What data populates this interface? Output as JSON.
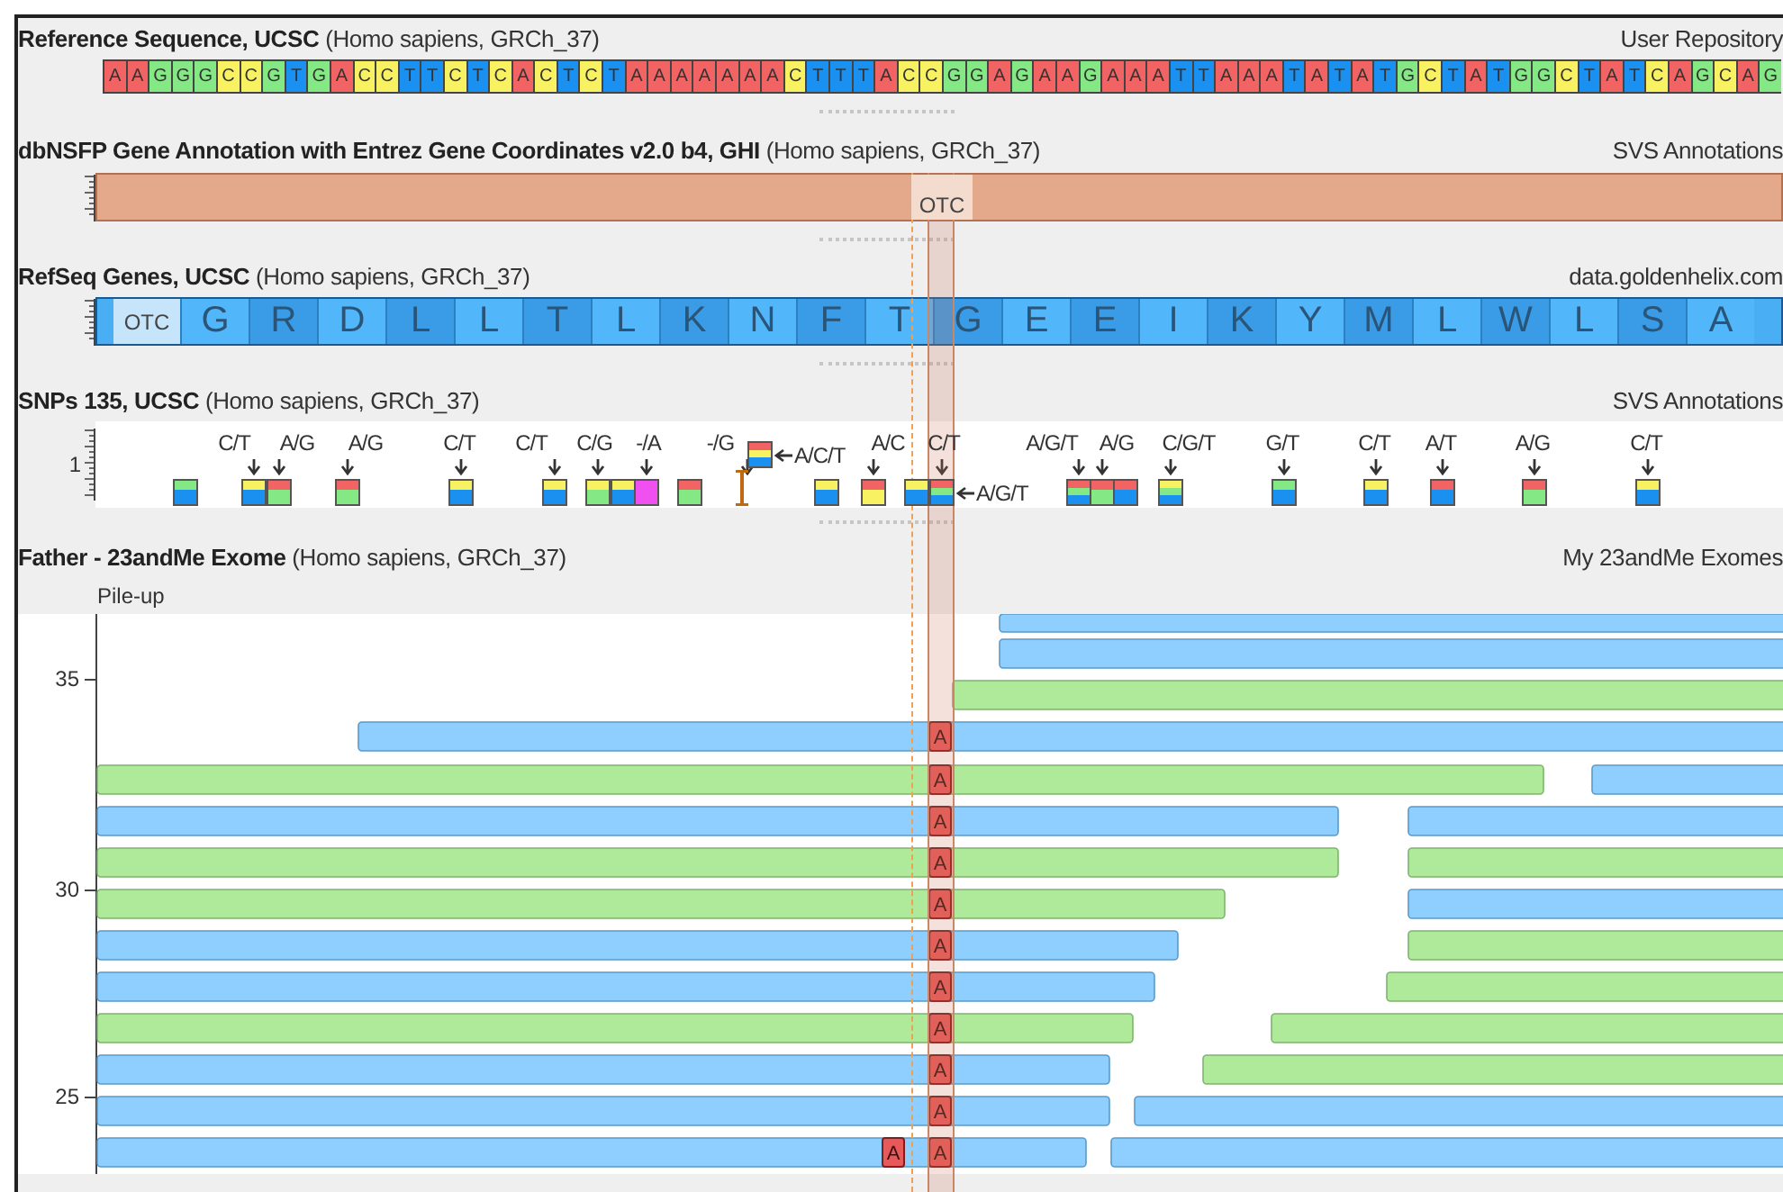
{
  "tracks": [
    {
      "kind": "sequence",
      "title": "**Reference Sequence, UCSC** (Homo sapiens, GRCh_37)",
      "source": "User Repository",
      "bases": [
        {
          "base": "A",
          "color": "#f26464"
        },
        {
          "base": "A",
          "color": "#f26464"
        },
        {
          "base": "G",
          "color": "#84e884"
        },
        {
          "base": "G",
          "color": "#84e884"
        },
        {
          "base": "G",
          "color": "#84e884"
        },
        {
          "base": "C",
          "color": "#f8f262"
        },
        {
          "base": "C",
          "color": "#f8f262"
        },
        {
          "base": "G",
          "color": "#84e884"
        },
        {
          "base": "T",
          "color": "#1a90f0"
        },
        {
          "base": "G",
          "color": "#84e884"
        },
        {
          "base": "A",
          "color": "#f26464"
        },
        {
          "base": "C",
          "color": "#f8f262"
        },
        {
          "base": "C",
          "color": "#f8f262"
        },
        {
          "base": "T",
          "color": "#1a90f0"
        },
        {
          "base": "T",
          "color": "#1a90f0"
        },
        {
          "base": "C",
          "color": "#f8f262"
        },
        {
          "base": "T",
          "color": "#1a90f0"
        },
        {
          "base": "C",
          "color": "#f8f262"
        },
        {
          "base": "A",
          "color": "#f26464"
        },
        {
          "base": "C",
          "color": "#f8f262"
        },
        {
          "base": "T",
          "color": "#1a90f0"
        },
        {
          "base": "C",
          "color": "#f8f262"
        },
        {
          "base": "T",
          "color": "#1a90f0"
        },
        {
          "base": "A",
          "color": "#f26464"
        },
        {
          "base": "A",
          "color": "#f26464"
        },
        {
          "base": "A",
          "color": "#f26464"
        },
        {
          "base": "A",
          "color": "#f26464"
        },
        {
          "base": "A",
          "color": "#f26464"
        },
        {
          "base": "A",
          "color": "#f26464"
        },
        {
          "base": "A",
          "color": "#f26464"
        },
        {
          "base": "C",
          "color": "#f8f262"
        },
        {
          "base": "T",
          "color": "#1a90f0"
        },
        {
          "base": "T",
          "color": "#1a90f0"
        },
        {
          "base": "T",
          "color": "#1a90f0"
        },
        {
          "base": "A",
          "color": "#f26464"
        },
        {
          "base": "C",
          "color": "#f8f262"
        },
        {
          "base": "C",
          "color": "#f8f262"
        },
        {
          "base": "G",
          "color": "#84e884"
        },
        {
          "base": "G",
          "color": "#84e884"
        },
        {
          "base": "A",
          "color": "#f26464"
        },
        {
          "base": "G",
          "color": "#84e884"
        },
        {
          "base": "A",
          "color": "#f26464"
        },
        {
          "base": "A",
          "color": "#f26464"
        },
        {
          "base": "G",
          "color": "#84e884"
        },
        {
          "base": "A",
          "color": "#f26464"
        },
        {
          "base": "A",
          "color": "#f26464"
        },
        {
          "base": "A",
          "color": "#f26464"
        },
        {
          "base": "T",
          "color": "#1a90f0"
        },
        {
          "base": "T",
          "color": "#1a90f0"
        },
        {
          "base": "A",
          "color": "#f26464"
        },
        {
          "base": "A",
          "color": "#f26464"
        },
        {
          "base": "A",
          "color": "#f26464"
        },
        {
          "base": "T",
          "color": "#1a90f0"
        },
        {
          "base": "A",
          "color": "#f26464"
        },
        {
          "base": "T",
          "color": "#1a90f0"
        },
        {
          "base": "A",
          "color": "#f26464"
        },
        {
          "base": "T",
          "color": "#1a90f0"
        },
        {
          "base": "G",
          "color": "#84e884"
        },
        {
          "base": "C",
          "color": "#f8f262"
        },
        {
          "base": "T",
          "color": "#1a90f0"
        },
        {
          "base": "A",
          "color": "#f26464"
        },
        {
          "base": "T",
          "color": "#1a90f0"
        },
        {
          "base": "G",
          "color": "#84e884"
        },
        {
          "base": "G",
          "color": "#84e884"
        },
        {
          "base": "C",
          "color": "#f8f262"
        },
        {
          "base": "T",
          "color": "#1a90f0"
        },
        {
          "base": "A",
          "color": "#f26464"
        },
        {
          "base": "T",
          "color": "#1a90f0"
        },
        {
          "base": "C",
          "color": "#f8f262"
        },
        {
          "base": "A",
          "color": "#f26464"
        },
        {
          "base": "G",
          "color": "#84e884"
        },
        {
          "base": "C",
          "color": "#f8f262"
        },
        {
          "base": "A",
          "color": "#f26464"
        },
        {
          "base": "G",
          "color": "#84e884"
        }
      ]
    },
    {
      "kind": "gene",
      "title": "**dbNSFP Gene Annotation with Entrez Gene Coordinates v2.0 b4, GHI** (Homo sapiens, GRCh_37)",
      "source": "SVS Annotations",
      "gene": "OTC"
    },
    {
      "kind": "protein",
      "title": "**RefSeq Genes, UCSC** (Homo sapiens, GRCh_37)",
      "source": "data.goldenhelix.com",
      "gene": "OTC",
      "amino_acids": [
        "G",
        "R",
        "D",
        "L",
        "L",
        "T",
        "L",
        "K",
        "N",
        "F",
        "T",
        "G",
        "E",
        "E",
        "I",
        "K",
        "Y",
        "M",
        "L",
        "W",
        "L",
        "S",
        "A"
      ]
    },
    {
      "kind": "variants",
      "title": "**SNPs 135, UCSC** (Homo sapiens, GRCh_37)",
      "source": "SVS Annotations",
      "scale_label": "1",
      "snps": [
        {
          "kind": "marker",
          "stripes": [
            {
              "color": "#84e884"
            },
            {
              "color": "#1a90f0"
            }
          ]
        },
        {
          "kind": "marker",
          "label": "C/T",
          "stripes": [
            {
              "color": "#f8f262"
            },
            {
              "color": "#1a90f0"
            }
          ]
        },
        {
          "kind": "marker",
          "label": "A/G",
          "stripes": [
            {
              "color": "#f26464"
            },
            {
              "color": "#84e884"
            }
          ]
        },
        {
          "kind": "marker",
          "label": "A/G",
          "stripes": [
            {
              "color": "#f26464"
            },
            {
              "color": "#84e884"
            }
          ]
        },
        {
          "kind": "marker",
          "label": "C/T",
          "stripes": [
            {
              "color": "#f8f262"
            },
            {
              "color": "#1a90f0"
            }
          ]
        },
        {
          "kind": "marker",
          "label": "C/T",
          "stripes": [
            {
              "color": "#f8f262"
            },
            {
              "color": "#1a90f0"
            }
          ]
        },
        {
          "kind": "marker",
          "label": "C/G",
          "stripes": [
            {
              "color": "#f8f262"
            },
            {
              "color": "#84e884"
            }
          ]
        },
        {
          "kind": "marker",
          "stripes": [
            {
              "color": "#f8f262"
            },
            {
              "color": "#1a90f0"
            }
          ]
        },
        {
          "kind": "marker",
          "label": "-/A",
          "stripes": [
            {
              "color": "#f050f0"
            }
          ]
        },
        {
          "kind": "marker",
          "stripes": [
            {
              "color": "#f26464"
            },
            {
              "color": "#84e884"
            }
          ]
        },
        {
          "kind": "insertion",
          "label": "-/G"
        },
        {
          "kind": "raised",
          "side_label": "A/C/T",
          "stripes": [
            {
              "color": "#f26464"
            },
            {
              "color": "#f8f262"
            },
            {
              "color": "#1a90f0"
            }
          ]
        },
        {
          "kind": "marker",
          "stripes": [
            {
              "color": "#f8f262"
            },
            {
              "color": "#1a90f0"
            }
          ]
        },
        {
          "kind": "marker",
          "label": "A/C",
          "stripes": [
            {
              "color": "#f26464"
            },
            {
              "color": "#f8f262"
            }
          ]
        },
        {
          "kind": "marker",
          "stripes": [
            {
              "color": "#f8f262"
            },
            {
              "color": "#1a90f0"
            }
          ]
        },
        {
          "kind": "marker",
          "label": "C/T",
          "side_label": "A/G/T",
          "stripes": [
            {
              "color": "#f26464"
            },
            {
              "color": "#84e884"
            },
            {
              "color": "#1a90f0"
            }
          ]
        },
        {
          "kind": "marker",
          "label": "A/G/T",
          "stripes": [
            {
              "color": "#f26464"
            },
            {
              "color": "#84e884"
            },
            {
              "color": "#1a90f0"
            }
          ]
        },
        {
          "kind": "marker",
          "label": "A/G",
          "stripes": [
            {
              "color": "#f26464"
            },
            {
              "color": "#84e884"
            }
          ]
        },
        {
          "kind": "marker",
          "stripes": [
            {
              "color": "#f26464"
            },
            {
              "color": "#1a90f0"
            }
          ]
        },
        {
          "kind": "marker",
          "label": "C/G/T",
          "stripes": [
            {
              "color": "#f8f262"
            },
            {
              "color": "#84e884"
            },
            {
              "color": "#1a90f0"
            }
          ]
        },
        {
          "kind": "marker",
          "label": "G/T",
          "stripes": [
            {
              "color": "#84e884"
            },
            {
              "color": "#1a90f0"
            }
          ]
        },
        {
          "kind": "marker",
          "label": "C/T",
          "stripes": [
            {
              "color": "#f8f262"
            },
            {
              "color": "#1a90f0"
            }
          ]
        },
        {
          "kind": "marker",
          "label": "A/T",
          "stripes": [
            {
              "color": "#f26464"
            },
            {
              "color": "#1a90f0"
            }
          ]
        },
        {
          "kind": "marker",
          "label": "A/G",
          "stripes": [
            {
              "color": "#f26464"
            },
            {
              "color": "#84e884"
            }
          ]
        },
        {
          "kind": "marker",
          "label": "C/T",
          "stripes": [
            {
              "color": "#f8f262"
            },
            {
              "color": "#1a90f0"
            }
          ]
        }
      ]
    },
    {
      "kind": "pileup",
      "title": "**Father - 23andMe Exome** (Homo sapiens, GRCh_37)",
      "source": "My 23andMe Exomes",
      "subtitle": "Pile-up",
      "y_ticks": [
        "35",
        "30",
        "25"
      ],
      "mismatches": [
        {
          "base": "A"
        },
        {
          "base": "A"
        },
        {
          "base": "A"
        },
        {
          "base": "A"
        },
        {
          "base": "A"
        },
        {
          "base": "A"
        },
        {
          "base": "A"
        },
        {
          "base": "A"
        },
        {
          "base": "A"
        },
        {
          "base": "A"
        },
        {
          "base": "A"
        },
        {
          "base": "A"
        }
      ]
    }
  ]
}
